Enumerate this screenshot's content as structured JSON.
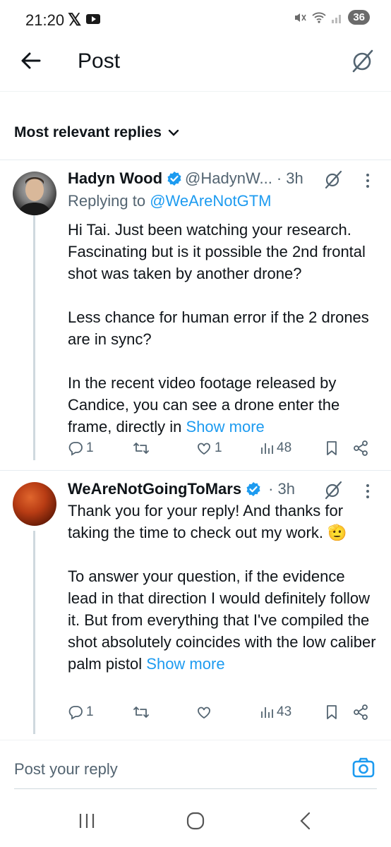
{
  "status": {
    "time": "21:20",
    "battery": "36"
  },
  "header": {
    "title": "Post"
  },
  "sort": {
    "label": "Most relevant replies"
  },
  "replies": [
    {
      "name": "Hadyn Wood",
      "handle": "@HadynW...",
      "time": "· 3h",
      "replying_prefix": "Replying to",
      "replying_to": "@WeAreNotGTM",
      "paragraphs": [
        "Hi Tai. Just been watching your research. Fascinating but is it possible the 2nd frontal shot was taken by another drone?",
        "Less chance for human error if the 2 drones are in sync?",
        "In the recent video footage released by Candice, you can see a drone enter the frame, directly in"
      ],
      "show_more": "Show more",
      "replies_count": "1",
      "reposts_count": "",
      "likes_count": "1",
      "views_count": "48"
    },
    {
      "name": "WeAreNotGoingToMars",
      "handle": "",
      "time": "· 3h",
      "paragraphs": [
        "Thank you for your reply! And thanks for taking the time to check out my work. 🫡",
        "To answer your question, if the evidence lead in that direction I would definitely follow it. But from everything that I've compiled the shot absolutely coincides with the low caliber palm pistol"
      ],
      "show_more": "Show more",
      "replies_count": "1",
      "reposts_count": "",
      "likes_count": "",
      "views_count": "43"
    }
  ],
  "composer": {
    "placeholder": "Post your reply"
  },
  "colors": {
    "accent": "#1d9bf0",
    "muted": "#536471",
    "text": "#0f1419"
  },
  "icons": [
    "back-arrow-icon",
    "grok-icon",
    "chevron-down-icon",
    "verified-badge-icon",
    "more-icon",
    "reply-icon",
    "repost-icon",
    "like-icon",
    "views-icon",
    "bookmark-icon",
    "share-icon",
    "camera-icon"
  ]
}
